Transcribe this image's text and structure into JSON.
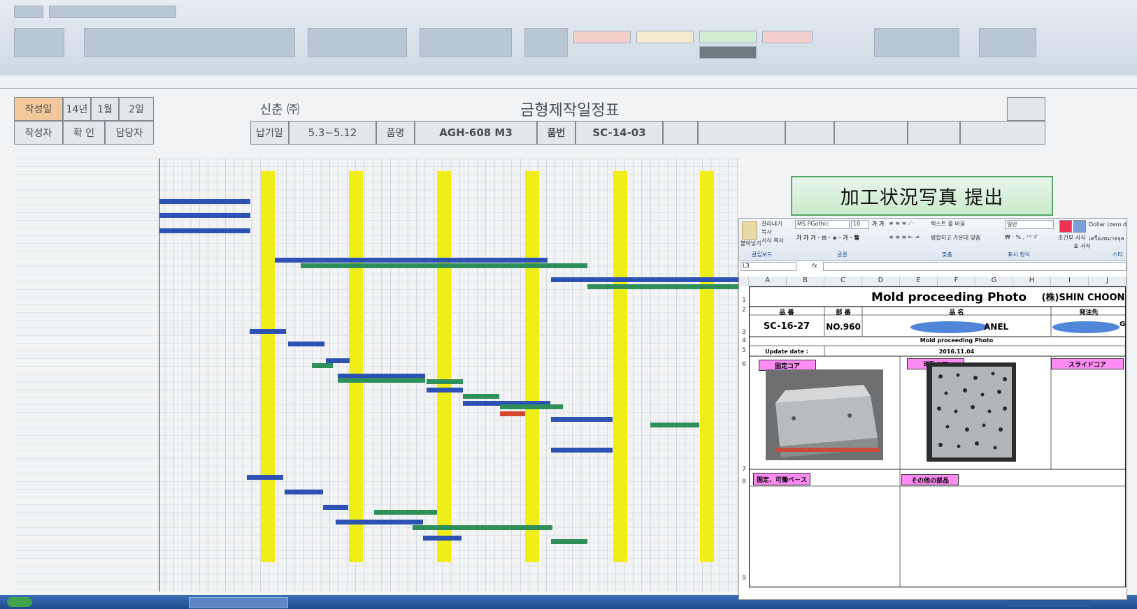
{
  "schedule": {
    "header_left_1": "작성일",
    "header_left_2": "14년",
    "header_left_3": "1월",
    "header_left_4": "2일",
    "row2_1": "작성자",
    "row2_2": "확 인",
    "row2_3": "담당자",
    "company": "신춘 ㈜",
    "title": "금형제작일정표",
    "lbl_due": "납기일",
    "due": "5.3~5.12",
    "lbl_product": "품명",
    "product": "AGH-608 M3",
    "lbl_part_no": "품번",
    "part_no": "SC-14-03"
  },
  "overlay": {
    "banner": "加工状況写真 提出",
    "font_name": "MS PGothic",
    "font_size": "10",
    "number_format": "일반",
    "cell_ref": "L3",
    "fx": "fx",
    "wrap_text": "텍스트 줄 바꿈",
    "merge_center": "병합하고 가운데 맞춤",
    "percent_group": "표시 형식",
    "clipboard_cut": "잘라내기",
    "clipboard_copy": "복사",
    "clipboard_format": "서식 복사",
    "paste": "붙여넣기",
    "grp_clipboard": "클립보드",
    "grp_font": "글꼴",
    "grp_align": "맞춤",
    "cond_format": "조건부 서식",
    "table_format": "표 서식",
    "style_label": "Dollar (zero de",
    "thai_label": "เครื่องหมายจุล",
    "grp_style": "스타",
    "columns": [
      "A",
      "B",
      "C",
      "D",
      "E",
      "F",
      "G",
      "H",
      "I",
      "J"
    ],
    "title": "Mold proceeding Photo",
    "company": "(株)SHIN CHOON",
    "h_part_no": "品 番",
    "h_part_num": "部 番",
    "h_name": "品 名",
    "h_customer": "発注先",
    "part_no": "SC-16-27",
    "part_num": "NO.960",
    "name_suffix": "ANEL",
    "customer_suffix": "G",
    "subtitle": "Mold proceeding Photo",
    "update_label": "Update date :",
    "update_date": "2016.11.04",
    "lbl_fixed_core": "固定コア",
    "lbl_movable_core": "可動コア",
    "lbl_slide_core": "スライドコア",
    "lbl_base": "固定、可働ベ－ス",
    "lbl_other": "その他の部品",
    "rows": [
      "1",
      "2",
      "3",
      "4",
      "5",
      "6",
      "7",
      "8",
      "9"
    ]
  }
}
